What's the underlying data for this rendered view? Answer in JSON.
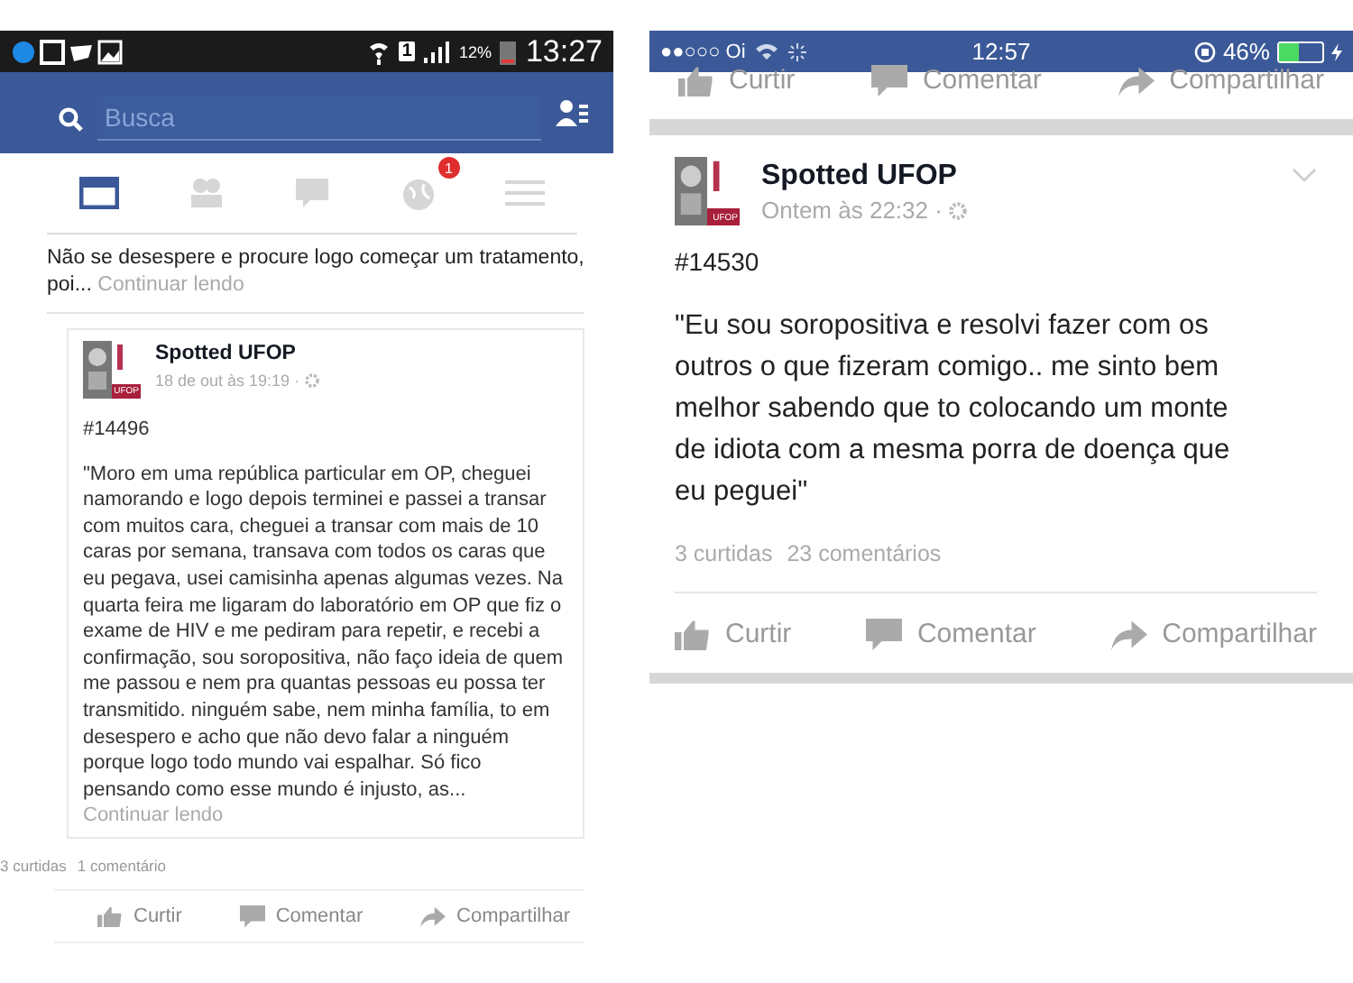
{
  "android_screen": {
    "status_bar": {
      "time": "13:27",
      "battery": "12%",
      "sim": "1"
    },
    "search": {
      "placeholder": "Busca"
    },
    "tabs": [
      {
        "kind": "feed",
        "selected": true
      },
      {
        "kind": "friends",
        "selected": false
      },
      {
        "kind": "messages",
        "selected": false
      },
      {
        "kind": "notifications",
        "selected": false,
        "badge": "1"
      },
      {
        "kind": "menu",
        "selected": false
      }
    ],
    "previous_post": {
      "text": "Não se desespere e procure logo começar um tratamento, poi...",
      "more": "Continuar lendo"
    },
    "shared_post": {
      "page": "Spotted UFOP",
      "logo_tag": "UFOP",
      "time": "18 de out às 19:19 ·",
      "number": "#14496",
      "text": "\"Moro em uma república particular em OP, cheguei namorando e logo depois terminei e passei a transar com muitos cara, cheguei a transar com mais de 10 caras por semana, transava com todos os caras que eu pegava, usei camisinha apenas algumas vezes. Na quarta feira me ligaram do laboratório em OP que fiz o exame de HIV e me pediram para repetir, e recebi a confirmação, sou soropositiva, não faço ideia de quem me passou e nem pra quantas pessoas eu possa ter transmitido. ninguém sabe, nem minha família, to em desespero e acho que não devo falar a ninguém porque logo todo mundo vai espalhar. Só fico pensando como esse mundo é injusto, as...",
      "more": "Continuar lendo"
    },
    "stats": {
      "likes": "3 curtidas",
      "comments": "1 comentário"
    },
    "actions": [
      {
        "kind": "like",
        "label": "Curtir"
      },
      {
        "kind": "comment",
        "label": "Comentar"
      },
      {
        "kind": "share",
        "label": "Compartilhar"
      }
    ]
  },
  "ios_screen": {
    "status_bar": {
      "carrier": "●●○○○ Oi",
      "time": "12:57",
      "battery": "46%"
    },
    "top_actions": [
      {
        "kind": "like",
        "label": "Curtir"
      },
      {
        "kind": "comment",
        "label": "Comentar"
      },
      {
        "kind": "share",
        "label": "Compartilhar"
      }
    ],
    "post": {
      "page": "Spotted UFOP",
      "logo_tag": "UFOP",
      "time": "Ontem às 22:32 ·",
      "number": "#14530",
      "text": "\"Eu sou soropositiva e resolvi fazer com os outros o que fizeram comigo.. me sinto bem melhor sabendo que to colocando um monte de idiota com a mesma porra de doença que eu peguei\"",
      "stats": {
        "likes": "3 curtidas",
        "comments": "23 comentários"
      },
      "actions": [
        {
          "kind": "like",
          "label": "Curtir"
        },
        {
          "kind": "comment",
          "label": "Comentar"
        },
        {
          "kind": "share",
          "label": "Compartilhar"
        }
      ]
    }
  }
}
